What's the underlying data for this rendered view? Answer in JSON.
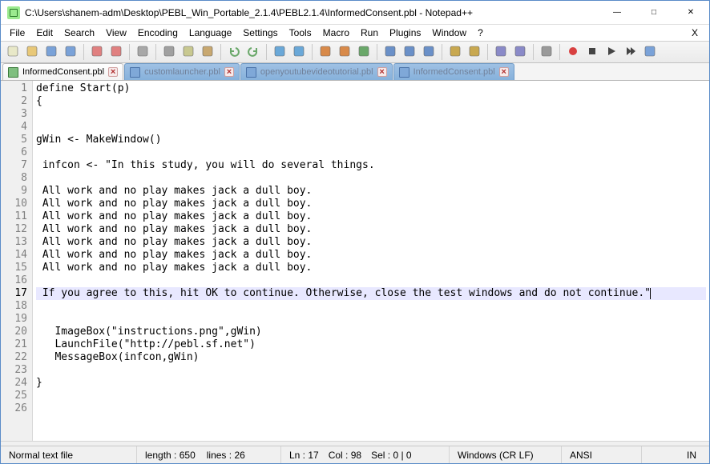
{
  "window": {
    "title": "C:\\Users\\shanem-adm\\Desktop\\PEBL_Win_Portable_2.1.4\\PEBL2.1.4\\InformedConsent.pbl - Notepad++"
  },
  "menu": {
    "items": [
      "File",
      "Edit",
      "Search",
      "View",
      "Encoding",
      "Language",
      "Settings",
      "Tools",
      "Macro",
      "Run",
      "Plugins",
      "Window",
      "?"
    ],
    "right_x": "X"
  },
  "toolbar": {
    "groups": [
      [
        "new-file",
        "open-file",
        "save",
        "save-all"
      ],
      [
        "close",
        "close-all"
      ],
      [
        "print"
      ],
      [
        "cut",
        "copy",
        "paste"
      ],
      [
        "undo",
        "redo"
      ],
      [
        "find",
        "replace"
      ],
      [
        "zoom-in",
        "zoom-out",
        "sync"
      ],
      [
        "word-wrap",
        "show-all",
        "indent-guide"
      ],
      [
        "lang-udl",
        "folder-doc"
      ],
      [
        "function-list",
        "doc-map"
      ],
      [
        "monitor"
      ],
      [
        "record",
        "stop",
        "play",
        "play-multi",
        "save-macro"
      ]
    ]
  },
  "tabs": [
    {
      "label": "InformedConsent.pbl",
      "active": true,
      "style": "green"
    },
    {
      "label": "customlauncher.pbl",
      "active": false,
      "style": "blue"
    },
    {
      "label": "openyoutubevideotutorial.pbl",
      "active": false,
      "style": "blue"
    },
    {
      "label": "InformedConsent.pbl",
      "active": false,
      "style": "blue"
    }
  ],
  "editor": {
    "lines": [
      "define Start(p)",
      "{",
      "",
      "",
      "gWin <- MakeWindow()",
      "",
      " infcon <- \"In this study, you will do several things.",
      "",
      " All work and no play makes jack a dull boy.",
      " All work and no play makes jack a dull boy.",
      " All work and no play makes jack a dull boy.",
      " All work and no play makes jack a dull boy.",
      " All work and no play makes jack a dull boy.",
      " All work and no play makes jack a dull boy.",
      " All work and no play makes jack a dull boy.",
      "",
      " If you agree to this, hit OK to continue. Otherwise, close the test windows and do not continue.\"",
      "",
      "",
      "   ImageBox(\"instructions.png\",gWin)",
      "   LaunchFile(\"http://pebl.sf.net\")",
      "   MessageBox(infcon,gWin)",
      "",
      "}",
      "",
      ""
    ],
    "highlight_line": 17,
    "underline_in_line": {
      "line": 21,
      "text": "http://pebl.sf.net"
    }
  },
  "status": {
    "filetype": "Normal text file",
    "length_label": "length :",
    "length_value": "650",
    "lines_label": "lines :",
    "lines_value": "26",
    "ln_label": "Ln :",
    "ln_value": "17",
    "col_label": "Col :",
    "col_value": "98",
    "sel_label": "Sel :",
    "sel_value": "0 | 0",
    "eol": "Windows (CR LF)",
    "encoding": "ANSI",
    "insert_mode": "IN"
  }
}
